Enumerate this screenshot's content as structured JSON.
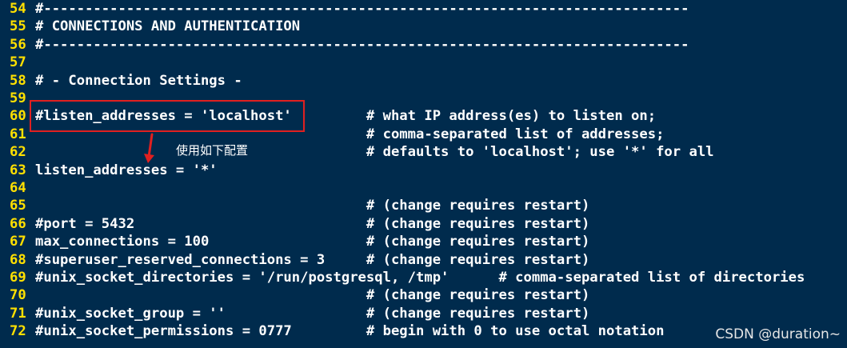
{
  "editor": {
    "lines": [
      {
        "num": "54",
        "text": "#------------------------------------------------------------------------------"
      },
      {
        "num": "55",
        "text": "# CONNECTIONS AND AUTHENTICATION"
      },
      {
        "num": "56",
        "text": "#------------------------------------------------------------------------------"
      },
      {
        "num": "57",
        "text": ""
      },
      {
        "num": "58",
        "text": "# - Connection Settings -"
      },
      {
        "num": "59",
        "text": ""
      },
      {
        "num": "60",
        "text": "#listen_addresses = 'localhost'         # what IP address(es) to listen on;"
      },
      {
        "num": "61",
        "text": "                                        # comma-separated list of addresses;"
      },
      {
        "num": "62",
        "text": "                                        # defaults to 'localhost'; use '*' for all"
      },
      {
        "num": "63",
        "text": "listen_addresses = '*'"
      },
      {
        "num": "64",
        "text": ""
      },
      {
        "num": "65",
        "text": "                                        # (change requires restart)"
      },
      {
        "num": "66",
        "text": "#port = 5432                            # (change requires restart)"
      },
      {
        "num": "67",
        "text": "max_connections = 100                   # (change requires restart)"
      },
      {
        "num": "68",
        "text": "#superuser_reserved_connections = 3     # (change requires restart)"
      },
      {
        "num": "69",
        "text": "#unix_socket_directories = '/run/postgresql, /tmp'      # comma-separated list of directories"
      },
      {
        "num": "70",
        "text": "                                        # (change requires restart)"
      },
      {
        "num": "71",
        "text": "#unix_socket_group = ''                 # (change requires restart)"
      },
      {
        "num": "72",
        "text": "#unix_socket_permissions = 0777         # begin with 0 to use octal notation"
      }
    ]
  },
  "annotation": {
    "text": "使用如下配置",
    "color": "#e02020"
  },
  "watermark": {
    "text": "CSDN @duration~"
  },
  "colors": {
    "background": "#002b4d",
    "line_number": "#ffe000",
    "code_text": "#ffffff"
  }
}
